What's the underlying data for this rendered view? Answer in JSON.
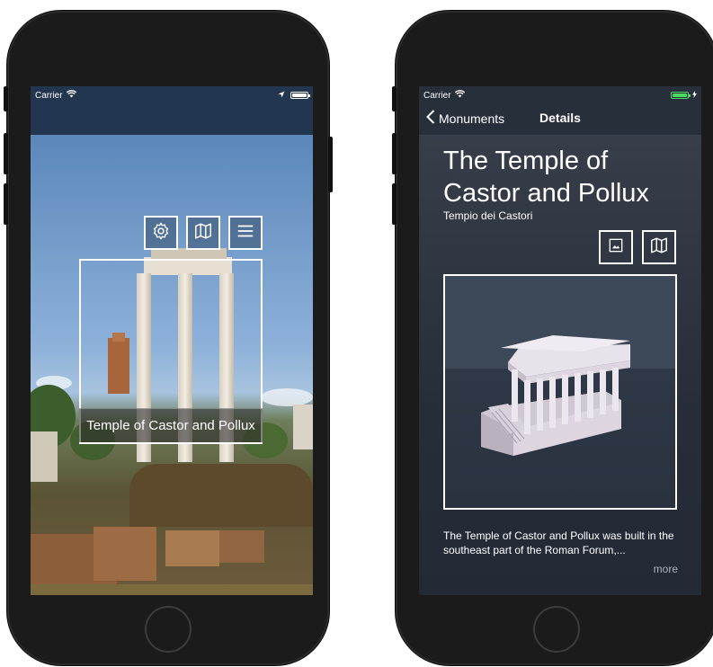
{
  "left_phone": {
    "status": {
      "carrier": "Carrier"
    },
    "overlay_buttons": [
      {
        "icon": "gear-icon"
      },
      {
        "icon": "map-icon"
      },
      {
        "icon": "menu-icon"
      }
    ],
    "monument_label": "Temple of Castor and Pollux"
  },
  "right_phone": {
    "status": {
      "carrier": "Carrier"
    },
    "nav": {
      "back_label": "Monuments",
      "title": "Details"
    },
    "title": "The Temple of Castor and Pollux",
    "subtitle": "Tempio dei Castori",
    "action_buttons": [
      {
        "icon": "image-icon"
      },
      {
        "icon": "map-icon"
      }
    ],
    "description": "The Temple of Castor and Pollux was built in the southeast part of the Roman Forum,...",
    "more_label": "more"
  },
  "colors": {
    "nav_left": "#22364f",
    "nav_right": "#272f3b",
    "battery_charging": "#4cd964"
  }
}
